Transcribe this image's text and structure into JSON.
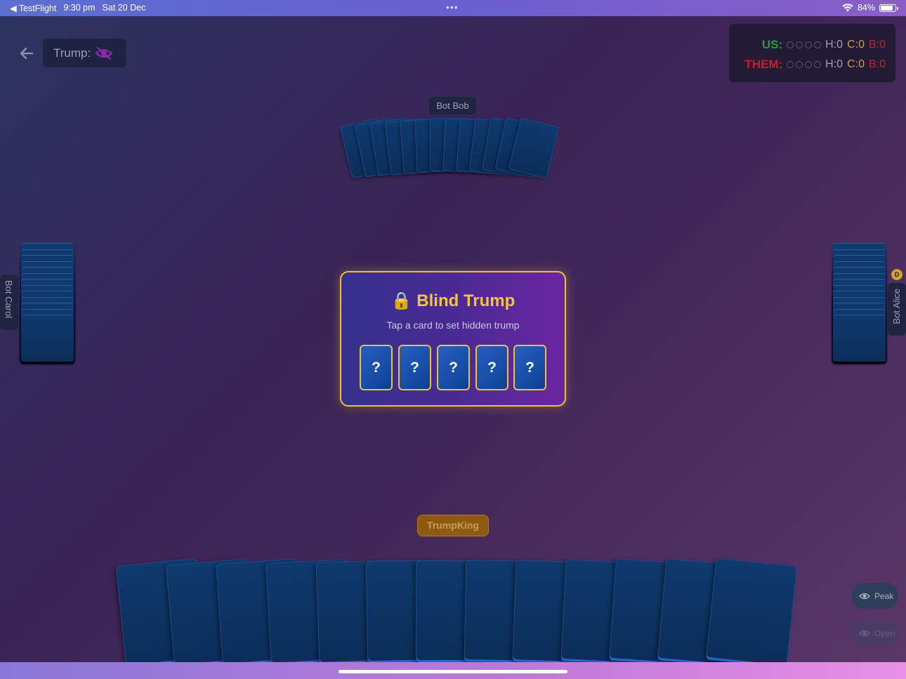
{
  "status_bar": {
    "back_app": "◀ TestFlight",
    "time": "9:30 pm",
    "date": "Sat 20 Dec",
    "dots": "•••",
    "battery": "84%"
  },
  "header": {
    "trump_label": "Trump:",
    "trump_icon": "eye-off-icon"
  },
  "score": {
    "us_label": "US:",
    "them_label": "THEM:",
    "us": {
      "h": "H:0",
      "c": "C:0",
      "b": "B:0"
    },
    "them": {
      "h": "H:0",
      "c": "C:0",
      "b": "B:0"
    }
  },
  "players": {
    "top": "Bot Bob",
    "left": "Bot Carol",
    "right": "Bot Alice",
    "dealer_badge": "D",
    "me": "TrumpKing"
  },
  "dialog": {
    "icon": "🔒",
    "title": "Blind Trump",
    "subtitle": "Tap a card to set hidden trump",
    "cards": [
      "?",
      "?",
      "?",
      "?",
      "?"
    ]
  },
  "buttons": {
    "peak": "Peak",
    "open": "Open"
  },
  "colors": {
    "accent_gold": "#f0c230",
    "us": "#2e9a3e",
    "them": "#c0222a",
    "card_blue": "#0f3a6e"
  }
}
